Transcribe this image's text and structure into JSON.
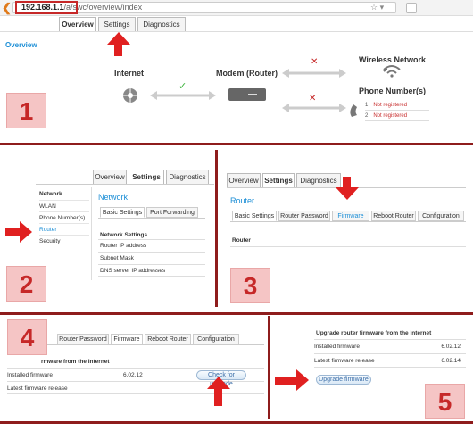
{
  "browser": {
    "host": "192.168.1.1",
    "path": "/a/swc/overview/index",
    "star": "☆",
    "dropdown": "▾"
  },
  "tabs": [
    "Overview",
    "Settings",
    "Diagnostics"
  ],
  "panel1": {
    "heading": "Overview",
    "internet": "Internet",
    "modem": "Modem (Router)",
    "wireless": "Wireless Network",
    "phone": "Phone Number(s)",
    "phone_lines": [
      {
        "num": "1",
        "status": "Not registered"
      },
      {
        "num": "2",
        "status": "Not registered"
      }
    ],
    "number": "1"
  },
  "panel2": {
    "sidebar": [
      "Network",
      "WLAN",
      "Phone Number(s)",
      "Router",
      "Security"
    ],
    "title": "Network",
    "subtabs": [
      "Basic Settings",
      "Port Forwarding"
    ],
    "section": "Network Settings",
    "fields": [
      "Router IP address",
      "Subnet Mask",
      "DNS server IP addresses"
    ],
    "number": "2"
  },
  "panel3": {
    "title": "Router",
    "subtabs": [
      "Basic Settings",
      "Router Password",
      "Firmware",
      "Reboot Router",
      "Configuration"
    ],
    "section": "Router",
    "number": "3"
  },
  "panel4": {
    "subtabs": [
      "Router Password",
      "Firmware",
      "Reboot Router",
      "Configuration"
    ],
    "section": "rmware from the Internet",
    "installed_label": "Installed firmware",
    "installed_value": "6.02.12",
    "latest_label": "Latest firmware release",
    "button": "Check for upgrade",
    "number": "4"
  },
  "panel5": {
    "section": "Upgrade router firmware from the Internet",
    "installed_label": "Installed firmware",
    "installed_value": "6.02.12",
    "latest_label": "Latest firmware release",
    "latest_value": "6.02.14",
    "button": "Upgrade firmware",
    "number": "5"
  }
}
